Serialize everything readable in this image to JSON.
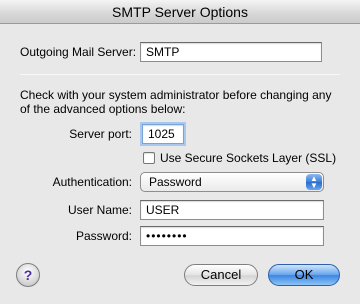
{
  "window": {
    "title": "SMTP Server Options"
  },
  "outgoing": {
    "label": "Outgoing Mail Server:",
    "value": "SMTP"
  },
  "notice": {
    "text": "Check with your system administrator before changing any of the advanced options below:"
  },
  "port": {
    "label": "Server port:",
    "value": "1025"
  },
  "ssl": {
    "label": "Use Secure Sockets Layer (SSL)",
    "checked": false
  },
  "auth": {
    "label": "Authentication:",
    "value": "Password"
  },
  "username": {
    "label": "User Name:",
    "value": "USER"
  },
  "password": {
    "label": "Password:",
    "value": "••••••••"
  },
  "buttons": {
    "help": "?",
    "cancel": "Cancel",
    "ok": "OK"
  }
}
